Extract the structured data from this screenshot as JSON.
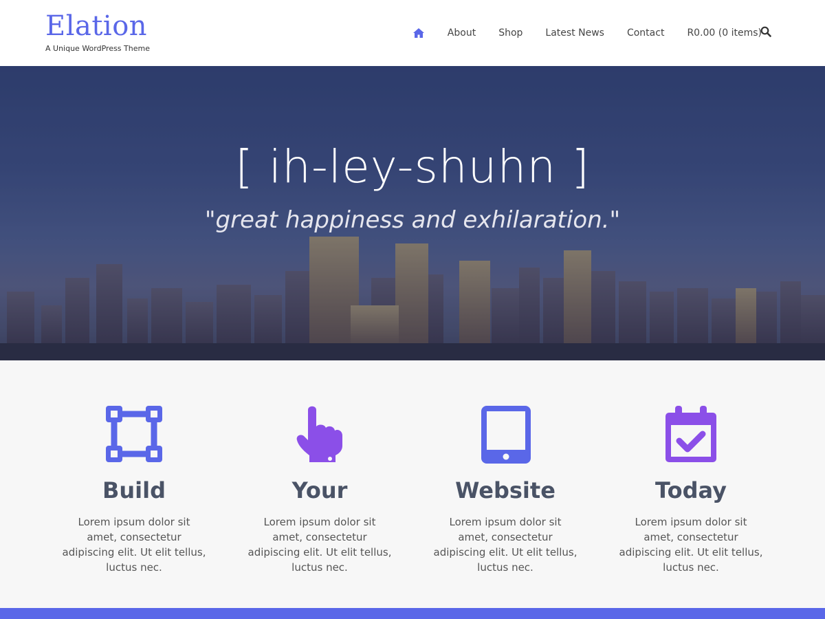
{
  "site": {
    "title": "Elation",
    "tagline": "A Unique WordPress Theme"
  },
  "nav": {
    "home_icon": "home-icon",
    "items": [
      {
        "label": "About"
      },
      {
        "label": "Shop"
      },
      {
        "label": "Latest News"
      },
      {
        "label": "Contact"
      },
      {
        "label": "R0.00 (0 items)"
      }
    ],
    "search_icon": "search-icon"
  },
  "hero": {
    "title": "[ ih-ley-shuhn ]",
    "subtitle": "\"great happiness and exhilaration.\""
  },
  "features": [
    {
      "icon": "vector-square-icon",
      "title": "Build",
      "text": "Lorem ipsum dolor sit amet, consectetur adipiscing elit. Ut elit tellus, luctus nec.",
      "color": "#5a67e8"
    },
    {
      "icon": "pointing-hand-icon",
      "title": "Your",
      "text": "Lorem ipsum dolor sit amet, consectetur adipiscing elit. Ut elit tellus, luctus nec.",
      "color": "#8b4fe8"
    },
    {
      "icon": "tablet-icon",
      "title": "Website",
      "text": "Lorem ipsum dolor sit amet, consectetur adipiscing elit. Ut elit tellus, luctus nec.",
      "color": "#5a67e8"
    },
    {
      "icon": "calendar-check-icon",
      "title": "Today",
      "text": "Lorem ipsum dolor sit amet, consectetur adipiscing elit. Ut elit tellus, luctus nec.",
      "color": "#8b4fe8"
    }
  ],
  "colors": {
    "accent": "#5a67e8",
    "accent_alt": "#8b4fe8"
  }
}
